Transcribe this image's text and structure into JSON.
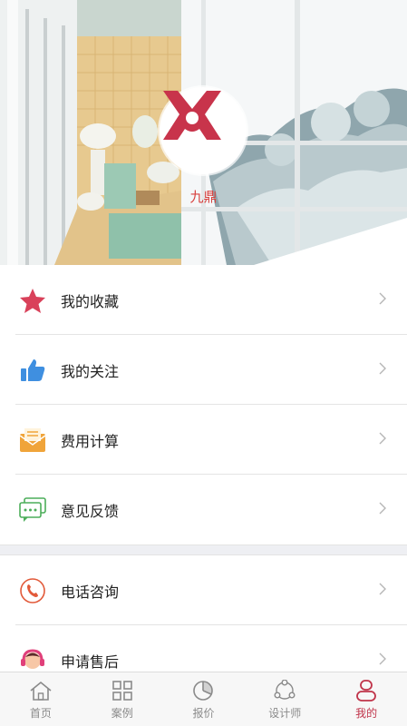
{
  "profile": {
    "name": "九鼎",
    "logo": "jiuding-logo"
  },
  "menu_group_1": [
    {
      "label": "我的收藏",
      "icon": "star-icon",
      "color": "#d9415a"
    },
    {
      "label": "我的关注",
      "icon": "thumbs-up-icon",
      "color": "#3f8fe0"
    },
    {
      "label": "费用计算",
      "icon": "envelope-icon",
      "color": "#f0a43a"
    },
    {
      "label": "意见反馈",
      "icon": "chat-bubbles-icon",
      "color": "#4cae5a"
    }
  ],
  "menu_group_2": [
    {
      "label": "电话咨询",
      "icon": "phone-icon",
      "color": "#e25a3a"
    },
    {
      "label": "申请售后",
      "icon": "headset-agent-icon",
      "color": "#e0407a"
    }
  ],
  "tabs": [
    {
      "label": "首页",
      "icon": "home-icon",
      "active": false
    },
    {
      "label": "案例",
      "icon": "grid-icon",
      "active": false
    },
    {
      "label": "报价",
      "icon": "pie-chart-icon",
      "active": false
    },
    {
      "label": "设计师",
      "icon": "share-nodes-icon",
      "active": false
    },
    {
      "label": "我的",
      "icon": "user-icon",
      "active": true
    }
  ],
  "colors": {
    "accent": "#c0344a",
    "inactive": "#8a8a8a",
    "brand_red": "#d8423f"
  }
}
